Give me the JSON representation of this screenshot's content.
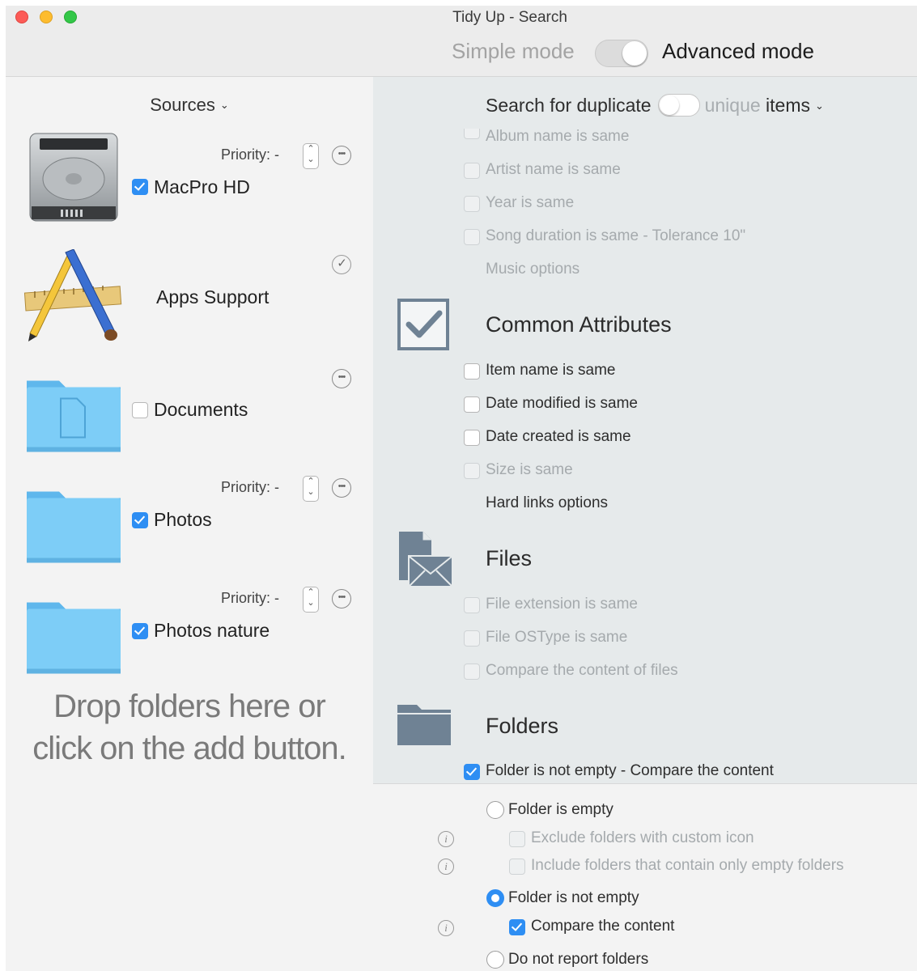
{
  "window": {
    "title": "Tidy Up - Search"
  },
  "mode": {
    "simple_label": "Simple mode",
    "advanced_label": "Advanced mode",
    "active": "advanced"
  },
  "sources": {
    "header": "Sources",
    "items": [
      {
        "name": "MacPro HD",
        "priority_label": "Priority: -",
        "checked": true,
        "icon": "hard-drive-icon"
      },
      {
        "name": "Apps Support",
        "checked": null,
        "icon": "applications-icon"
      },
      {
        "name": "Documents",
        "checked": false,
        "icon": "documents-folder-icon"
      },
      {
        "name": "Photos",
        "priority_label": "Priority: -",
        "checked": true,
        "icon": "folder-icon"
      },
      {
        "name": "Photos nature",
        "priority_label": "Priority: -",
        "checked": true,
        "icon": "folder-icon"
      }
    ],
    "drop_hint_line1": "Drop folders here or",
    "drop_hint_line2": "click on the add button."
  },
  "search": {
    "prefix": "Search for duplicate",
    "unique": "unique",
    "items": "items"
  },
  "music": {
    "options": [
      {
        "label": "Album name is same",
        "checked": false,
        "enabled": false
      },
      {
        "label": "Artist name is same",
        "checked": false,
        "enabled": false
      },
      {
        "label": "Year is same",
        "checked": false,
        "enabled": false
      },
      {
        "label": "Song duration is same - Tolerance 10\"",
        "checked": false,
        "enabled": false
      }
    ],
    "link": "Music options"
  },
  "common": {
    "title": "Common Attributes",
    "options": [
      {
        "label": "Item name is same",
        "checked": false,
        "enabled": true
      },
      {
        "label": "Date modified is same",
        "checked": false,
        "enabled": true
      },
      {
        "label": "Date created is same",
        "checked": false,
        "enabled": true
      },
      {
        "label": "Size is same",
        "checked": false,
        "enabled": false
      }
    ],
    "link": "Hard links options"
  },
  "files": {
    "title": "Files",
    "options": [
      {
        "label": "File extension is same",
        "checked": false,
        "enabled": false
      },
      {
        "label": "File OSType is same",
        "checked": false,
        "enabled": false
      },
      {
        "label": "Compare the content of files",
        "checked": false,
        "enabled": false
      }
    ]
  },
  "folders": {
    "title": "Folders",
    "summary": "Folder is not empty - Compare the content",
    "summary_checked": true,
    "empty_radio": "Folder is empty",
    "exclude_custom": "Exclude folders with custom icon",
    "include_empty": "Include folders that contain only empty folders",
    "not_empty_radio": "Folder is not empty",
    "compare_content": "Compare the content",
    "no_report_radio": "Do not report folders",
    "selected": "not_empty"
  },
  "colors": {
    "accent": "#2e8ef3",
    "panel": "#e6eaeb",
    "folder": "#6cc5f5"
  }
}
